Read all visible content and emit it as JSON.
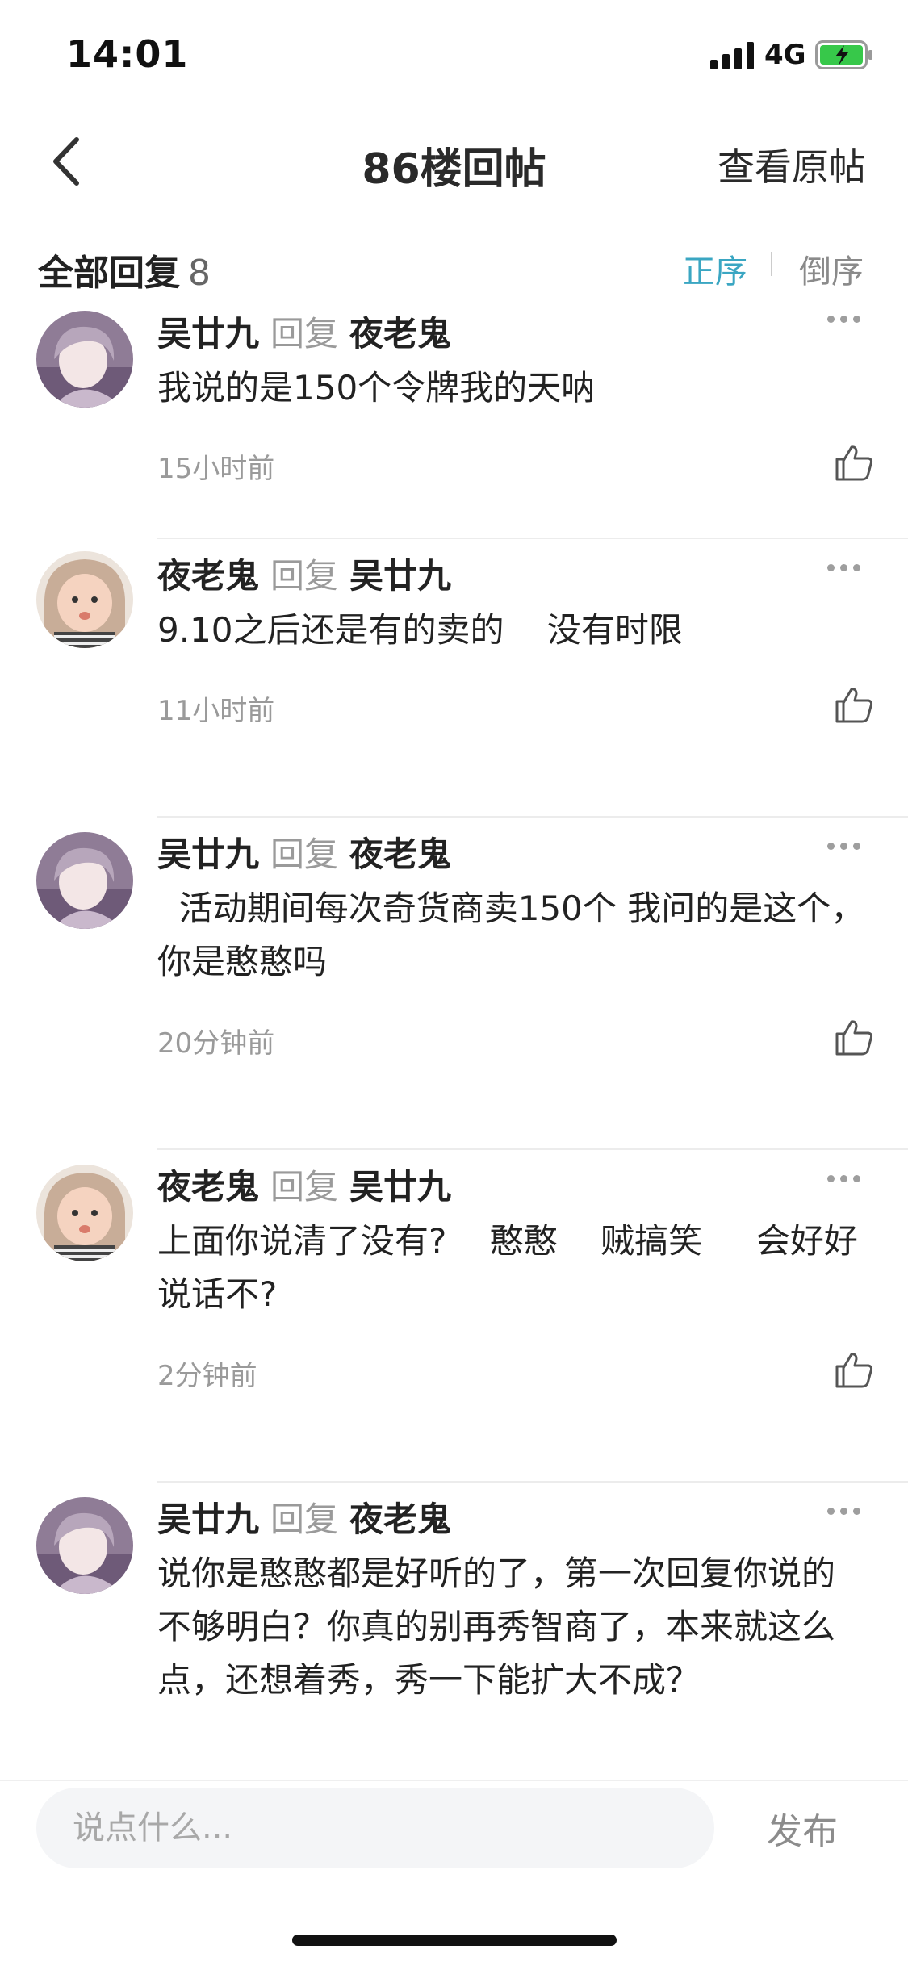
{
  "status_bar": {
    "time": "14:01",
    "network": "4G",
    "battery_charging": true
  },
  "nav": {
    "back_icon": "chevron-left-icon",
    "title": "86楼回帖",
    "right_action": "查看原帖"
  },
  "sort": {
    "all_replies_label": "全部回复",
    "count": "8",
    "asc_label": "正序",
    "desc_label": "倒序",
    "active_color": "#3aa6c2"
  },
  "comments": [
    {
      "user": "吴廿九",
      "reply_word": "回复",
      "target": "夜老鬼",
      "text": "我说的是150个令牌我的天呐",
      "time": "15小时前",
      "avatar": "anime-boy-avatar"
    },
    {
      "user": "夜老鬼",
      "reply_word": "回复",
      "target": "吴廿九",
      "text": "9.10之后还是有的卖的    没有时限",
      "time": "11小时前",
      "avatar": "toddler-avatar"
    },
    {
      "user": "吴廿九",
      "reply_word": "回复",
      "target": "夜老鬼",
      "text": "  活动期间每次奇货商卖150个 我问的是这个，你是憨憨吗",
      "time": "20分钟前",
      "avatar": "anime-boy-avatar"
    },
    {
      "user": "夜老鬼",
      "reply_word": "回复",
      "target": "吴廿九",
      "text": "上面你说清了没有?    憨憨    贼搞笑     会好好说话不?",
      "time": "2分钟前",
      "avatar": "toddler-avatar"
    },
    {
      "user": "吴廿九",
      "reply_word": "回复",
      "target": "夜老鬼",
      "text": "说你是憨憨都是好听的了，第一次回复你说的不够明白？你真的别再秀智商了，本来就这么点，还想着秀，秀一下能扩大不成？",
      "time": "",
      "avatar": "anime-boy-avatar"
    }
  ],
  "input": {
    "placeholder": "说点什么...",
    "value": "",
    "publish_label": "发布"
  }
}
